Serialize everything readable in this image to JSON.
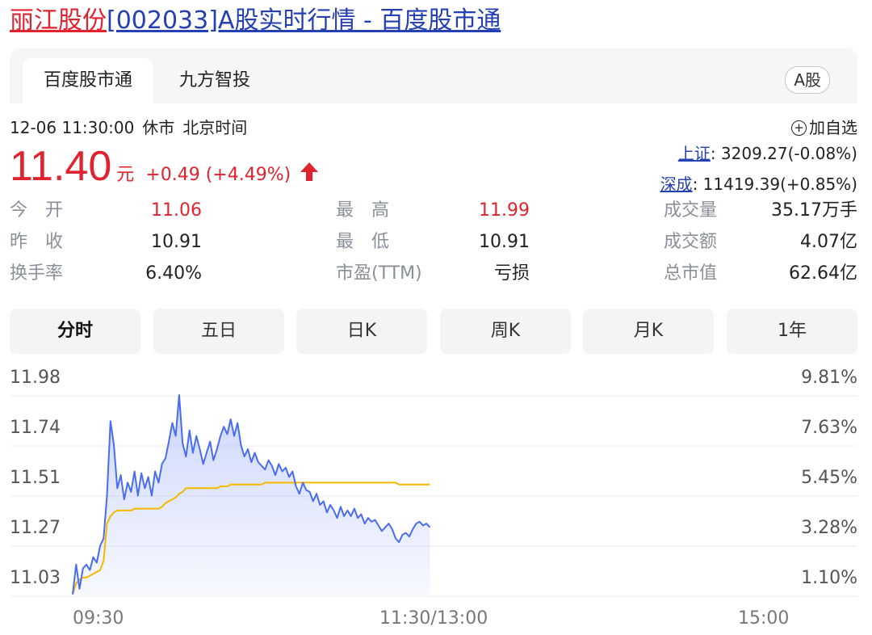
{
  "page_title": {
    "name_part": "丽江股份",
    "rest_part": "[002033]A股实时行情 - 百度股市通"
  },
  "tabs": {
    "active": "百度股市通",
    "second": "九方智投",
    "badge": "A股"
  },
  "status": {
    "datetime": "12-06 11:30:00",
    "state": "休市",
    "timezone": "北京时间"
  },
  "add_watch": "加自选",
  "quote": {
    "price": "11.40",
    "unit": "元",
    "change": "+0.49 (+4.49%)"
  },
  "indices": [
    {
      "name": "上证",
      "value": ": 3209.27(-0.08%)"
    },
    {
      "name": "深成",
      "value": ": 11419.39(+0.85%)"
    }
  ],
  "stats": [
    {
      "label": "今　开",
      "value": "11.06",
      "color": "red"
    },
    {
      "label": "最　高",
      "value": "11.99",
      "color": "red"
    },
    {
      "label": "成交量",
      "value": "35.17万手",
      "color": "black"
    },
    {
      "label": "昨　收",
      "value": "10.91",
      "color": "black"
    },
    {
      "label": "最　低",
      "value": "10.91",
      "color": "black"
    },
    {
      "label": "成交额",
      "value": "4.07亿",
      "color": "black"
    },
    {
      "label": "换手率",
      "value": "6.40%",
      "color": "black"
    },
    {
      "label": "市盈(TTM)",
      "value": "亏损",
      "color": "black"
    },
    {
      "label": "总市值",
      "value": "62.64亿",
      "color": "black"
    }
  ],
  "period_tabs": [
    "分时",
    "五日",
    "日K",
    "周K",
    "月K",
    "1年"
  ],
  "active_period": "分时",
  "colors": {
    "up": "#e0232e",
    "link": "#2440b3",
    "price_line": "#4a6cf0",
    "avg_line": "#f5b800"
  },
  "chart_data": {
    "type": "line",
    "y_left_ticks": [
      "11.98",
      "11.74",
      "11.51",
      "11.27",
      "11.03"
    ],
    "y_right_ticks": [
      "9.81%",
      "7.63%",
      "5.45%",
      "3.28%",
      "1.10%"
    ],
    "x_ticks": [
      "09:30",
      "11:30/13:00",
      "15:00"
    ],
    "ylim": [
      10.91,
      11.99
    ],
    "x_range_minutes": [
      0,
      240
    ],
    "series": [
      {
        "values": [
          10.92,
          11.08,
          10.95,
          11.06,
          11.08,
          11.05,
          11.12,
          11.09,
          11.18,
          11.22,
          11.45,
          11.85,
          11.72,
          11.49,
          11.56,
          11.43,
          11.52,
          11.47,
          11.58,
          11.45,
          11.57,
          11.49,
          11.55,
          11.45,
          11.58,
          11.52,
          11.62,
          11.65,
          11.74,
          11.84,
          11.77,
          11.99,
          11.73,
          11.66,
          11.8,
          11.68,
          11.77,
          11.7,
          11.62,
          11.68,
          11.74,
          11.64,
          11.7,
          11.77,
          11.82,
          11.78,
          11.86,
          11.77,
          11.84,
          11.72,
          11.66,
          11.7,
          11.63,
          11.68,
          11.63,
          11.61,
          11.59,
          11.64,
          11.61,
          11.56,
          11.62,
          11.58,
          11.6,
          11.55,
          11.58,
          11.5,
          11.46,
          11.52,
          11.48,
          11.47,
          11.42,
          11.46,
          11.4,
          11.42,
          11.36,
          11.4,
          11.37,
          11.33,
          11.39,
          11.34,
          11.37,
          11.34,
          11.38,
          11.33,
          11.35,
          11.3,
          11.33,
          11.31,
          11.32,
          11.29,
          11.26,
          11.28,
          11.3,
          11.27,
          11.22,
          11.2,
          11.24,
          11.25,
          11.23,
          11.27,
          11.3,
          11.31,
          11.29,
          11.3,
          11.28
        ]
      },
      {
        "values": [
          10.92,
          10.98,
          11.0,
          11.01,
          11.01,
          11.02,
          11.03,
          11.04,
          11.05,
          11.1,
          11.3,
          11.34,
          11.36,
          11.37,
          11.37,
          11.37,
          11.37,
          11.37,
          11.38,
          11.38,
          11.38,
          11.38,
          11.38,
          11.38,
          11.38,
          11.38,
          11.39,
          11.41,
          11.42,
          11.43,
          11.44,
          11.46,
          11.47,
          11.49,
          11.49,
          11.49,
          11.49,
          11.49,
          11.49,
          11.49,
          11.49,
          11.49,
          11.49,
          11.5,
          11.5,
          11.5,
          11.51,
          11.51,
          11.51,
          11.51,
          11.51,
          11.51,
          11.51,
          11.51,
          11.51,
          11.51,
          11.52,
          11.52,
          11.52,
          11.52,
          11.52,
          11.52,
          11.52,
          11.52,
          11.52,
          11.52,
          11.52,
          11.52,
          11.52,
          11.52,
          11.52,
          11.52,
          11.52,
          11.52,
          11.52,
          11.52,
          11.52,
          11.52,
          11.52,
          11.52,
          11.52,
          11.52,
          11.52,
          11.52,
          11.52,
          11.52,
          11.52,
          11.52,
          11.52,
          11.52,
          11.52,
          11.52,
          11.52,
          11.52,
          11.52,
          11.51,
          11.51,
          11.51,
          11.51,
          11.51,
          11.51,
          11.51,
          11.51,
          11.51,
          11.51
        ]
      }
    ]
  }
}
